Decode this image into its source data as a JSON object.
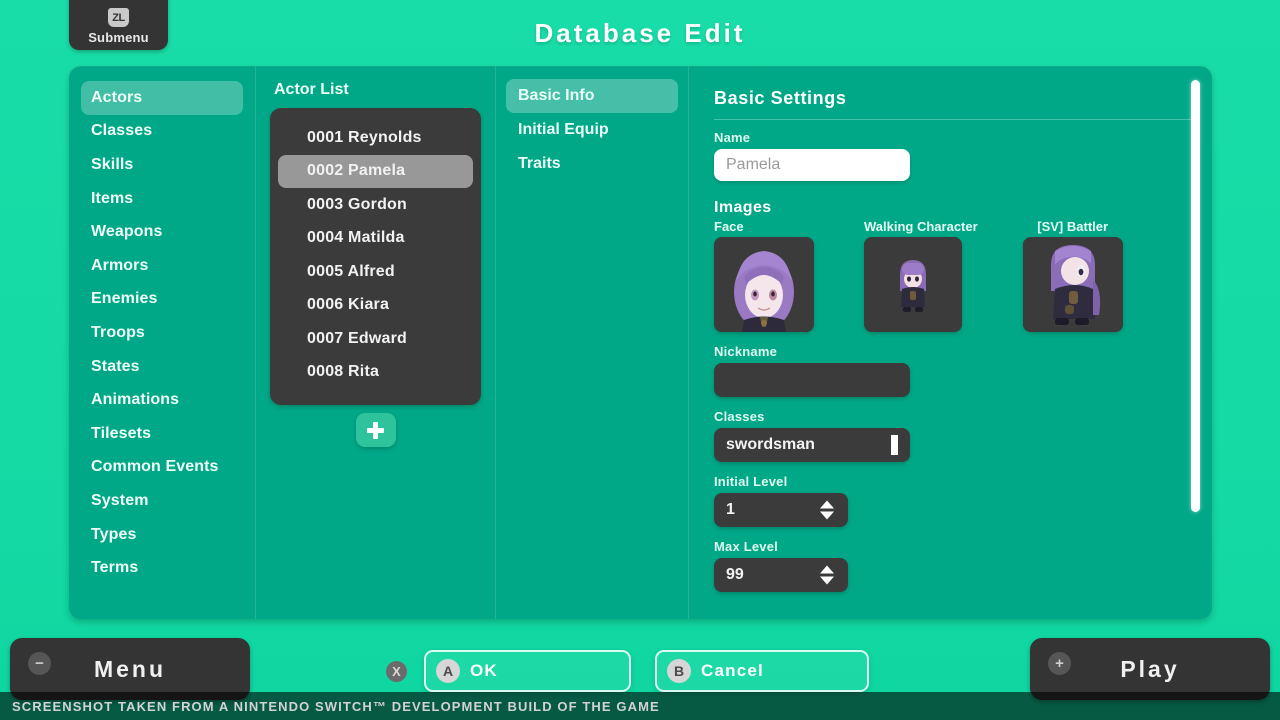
{
  "header": {
    "title": "Database Edit",
    "submenu_button": {
      "glyph": "ZL",
      "label": "Submenu"
    }
  },
  "sidebar": {
    "items": [
      {
        "label": "Actors"
      },
      {
        "label": "Classes"
      },
      {
        "label": "Skills"
      },
      {
        "label": "Items"
      },
      {
        "label": "Weapons"
      },
      {
        "label": "Armors"
      },
      {
        "label": "Enemies"
      },
      {
        "label": "Troops"
      },
      {
        "label": "States"
      },
      {
        "label": "Animations"
      },
      {
        "label": "Tilesets"
      },
      {
        "label": "Common Events"
      },
      {
        "label": "System"
      },
      {
        "label": "Types"
      },
      {
        "label": "Terms"
      }
    ],
    "selected": "Actors"
  },
  "actor_list": {
    "header": "Actor List",
    "items": [
      {
        "label": "0001 Reynolds"
      },
      {
        "label": "0002 Pamela"
      },
      {
        "label": "0003 Gordon"
      },
      {
        "label": "0004 Matilda"
      },
      {
        "label": "0005 Alfred"
      },
      {
        "label": "0006 Kiara"
      },
      {
        "label": "0007 Edward"
      },
      {
        "label": "0008 Rita"
      }
    ],
    "selected": "0002 Pamela",
    "add_button_icon": "plus-icon"
  },
  "tabs": {
    "items": [
      {
        "label": "Basic Info"
      },
      {
        "label": "Initial Equip"
      },
      {
        "label": "Traits"
      }
    ],
    "selected": "Basic Info"
  },
  "detail": {
    "title": "Basic Settings",
    "name": {
      "label": "Name",
      "value": "Pamela"
    },
    "images": {
      "section_label": "Images",
      "slots": [
        {
          "caption": "Face"
        },
        {
          "caption": "Walking Character"
        },
        {
          "caption": "[SV] Battler"
        }
      ]
    },
    "nickname": {
      "label": "Nickname",
      "value": ""
    },
    "classes": {
      "label": "Classes",
      "value": "swordsman"
    },
    "initial_level": {
      "label": "Initial Level",
      "value": "1"
    },
    "max_level": {
      "label": "Max Level",
      "value": "99"
    }
  },
  "bottom_bar": {
    "menu": {
      "label": "Menu",
      "badge": "−"
    },
    "play": {
      "label": "Play",
      "badge": "+"
    },
    "x_badge": "X",
    "ok": {
      "button": "A",
      "label": "OK"
    },
    "cancel": {
      "button": "B",
      "label": "Cancel"
    }
  },
  "watermark": "SCREENSHOT TAKEN FROM A NINTENDO SWITCH™ DEVELOPMENT BUILD OF THE GAME",
  "colors": {
    "background": "#19dda8",
    "panel": "#00a887",
    "dark": "#3b3b3b",
    "accent": "#2fc39c",
    "selected_row": "#989898"
  }
}
